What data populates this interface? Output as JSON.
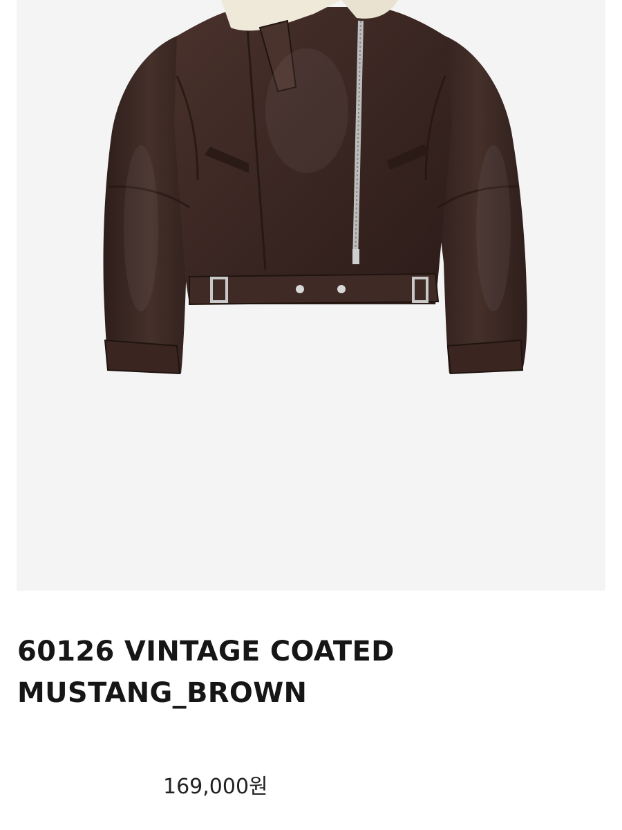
{
  "product": {
    "image_alt": "Brown leather shearling jacket",
    "name": "60126 VINTAGE COATED MUSTANG_BROWN",
    "price": "169,000원"
  },
  "colors": {
    "image_background": "#f4f4f4",
    "leather": "#3a2622",
    "shearling": "#efe9da",
    "text": "#161616"
  }
}
